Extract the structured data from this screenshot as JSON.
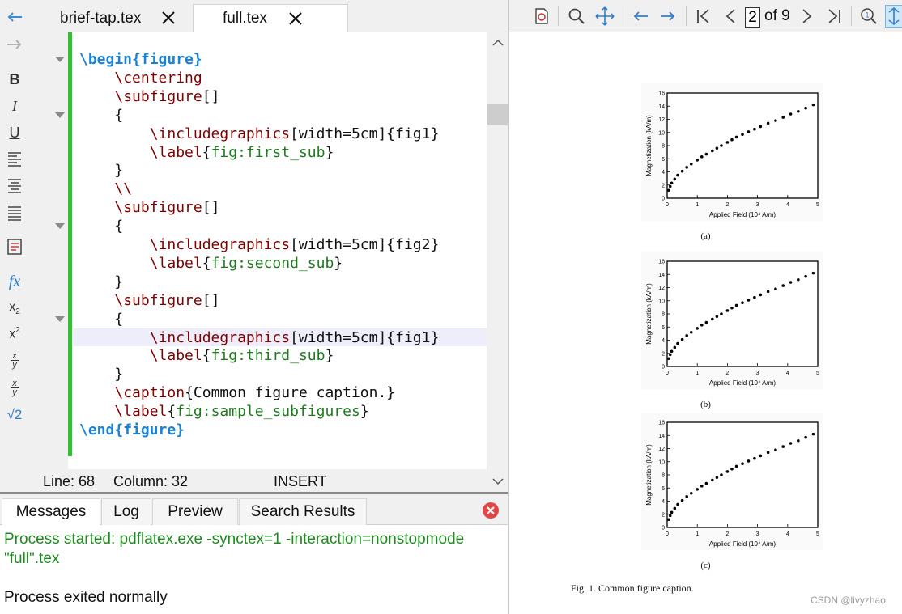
{
  "editor": {
    "tabs": [
      {
        "label": "brief-tap.tex",
        "active": false
      },
      {
        "label": "full.tex",
        "active": true
      }
    ],
    "lines": [
      {
        "indent": "",
        "parts": [
          [
            "kw",
            "\\begin"
          ],
          [
            "kw",
            "{"
          ],
          [
            "kw",
            "figure"
          ],
          [
            "kw",
            "}"
          ]
        ]
      },
      {
        "indent": "    ",
        "parts": [
          [
            "cmd",
            "\\centering"
          ]
        ]
      },
      {
        "indent": "    ",
        "parts": [
          [
            "cmd",
            "\\subfigure"
          ],
          [
            "",
            "[]"
          ]
        ]
      },
      {
        "indent": "    ",
        "parts": [
          [
            "",
            "{"
          ]
        ]
      },
      {
        "indent": "        ",
        "parts": [
          [
            "cmd",
            "\\includegraphics"
          ],
          [
            "",
            "[width=5cm]{fig1}"
          ]
        ]
      },
      {
        "indent": "        ",
        "parts": [
          [
            "cmd",
            "\\label"
          ],
          [
            "",
            "{"
          ],
          [
            "grn",
            "fig:first_sub"
          ],
          [
            "",
            "}"
          ]
        ]
      },
      {
        "indent": "    ",
        "parts": [
          [
            "",
            "}"
          ]
        ]
      },
      {
        "indent": "    ",
        "parts": [
          [
            "cmd",
            "\\\\"
          ]
        ]
      },
      {
        "indent": "    ",
        "parts": [
          [
            "cmd",
            "\\subfigure"
          ],
          [
            "",
            "[]"
          ]
        ]
      },
      {
        "indent": "    ",
        "parts": [
          [
            "",
            "{"
          ]
        ]
      },
      {
        "indent": "        ",
        "parts": [
          [
            "cmd",
            "\\includegraphics"
          ],
          [
            "",
            "[width=5cm]{fig2}"
          ]
        ]
      },
      {
        "indent": "        ",
        "parts": [
          [
            "cmd",
            "\\label"
          ],
          [
            "",
            "{"
          ],
          [
            "grn",
            "fig:second_sub"
          ],
          [
            "",
            "}"
          ]
        ]
      },
      {
        "indent": "    ",
        "parts": [
          [
            "",
            "}"
          ]
        ]
      },
      {
        "indent": "    ",
        "parts": [
          [
            "cmd",
            "\\subfigure"
          ],
          [
            "",
            "[]"
          ]
        ]
      },
      {
        "indent": "    ",
        "parts": [
          [
            "",
            "{"
          ]
        ]
      },
      {
        "indent": "        ",
        "parts": [
          [
            "cmd",
            "\\includegraphics"
          ],
          [
            "",
            "[width=5cm]{fig1}"
          ]
        ]
      },
      {
        "indent": "        ",
        "parts": [
          [
            "cmd",
            "\\label"
          ],
          [
            "",
            "{"
          ],
          [
            "grn",
            "fig:third_sub"
          ],
          [
            "",
            "}"
          ]
        ]
      },
      {
        "indent": "    ",
        "parts": [
          [
            "",
            "}"
          ]
        ]
      },
      {
        "indent": "    ",
        "parts": [
          [
            "cmd",
            "\\caption"
          ],
          [
            "",
            "{Common figure caption.}"
          ]
        ]
      },
      {
        "indent": "    ",
        "parts": [
          [
            "cmd",
            "\\label"
          ],
          [
            "",
            "{"
          ],
          [
            "grn",
            "fig:sample_subfigures"
          ],
          [
            "",
            "}"
          ]
        ]
      },
      {
        "indent": "",
        "parts": [
          [
            "kw",
            "\\end"
          ],
          [
            "kw",
            "{"
          ],
          [
            "kw",
            "figure"
          ],
          [
            "kw",
            "}"
          ]
        ]
      }
    ],
    "current_line_index": 15,
    "fold_lines": [
      0,
      3,
      9,
      14
    ]
  },
  "status": {
    "line": "Line: 68",
    "column": "Column: 32",
    "mode": "INSERT"
  },
  "bottom": {
    "tabs": [
      "Messages",
      "Log",
      "Preview",
      "Search Results"
    ],
    "active_tab": "Messages",
    "messages": [
      {
        "text": "Process started: pdflatex.exe -synctex=1 -interaction=nonstopmode",
        "color": "#1f8a1f"
      },
      {
        "text": "\"full\".tex",
        "color": "#1f8a1f"
      },
      {
        "text": "",
        "color": "#111111"
      },
      {
        "text": "Process exited normally",
        "color": "#111111"
      }
    ]
  },
  "left_toolbar": {
    "icons": [
      "back-arrow-icon",
      "forward-arrow-icon",
      "bold-icon",
      "italic-icon",
      "underline-icon",
      "align-left-icon",
      "align-center-icon",
      "align-justify-icon",
      "insert-item-icon",
      "function-fx-icon",
      "subscript-icon",
      "superscript-icon",
      "fraction-icon",
      "fraction-alt-icon",
      "square-root-icon"
    ]
  },
  "viewer": {
    "page_current": "2",
    "page_total_label": "of 9",
    "toolbar_icons": [
      "sync-pdf-icon",
      "zoom-icon",
      "pan-icon",
      "prev-arrow-icon",
      "next-arrow-icon",
      "first-page-icon",
      "prev-page-icon",
      "next-page-icon",
      "last-page-icon",
      "zoom-100-icon",
      "fit-icon"
    ],
    "watermark": "CSDN @livyzhao",
    "figure_caption": "Fig. 1.  Common figure caption.",
    "subcaptions": [
      "(a)",
      "(b)",
      "(c)"
    ]
  },
  "chart_data": [
    {
      "type": "scatter",
      "xlabel": "Applied Field (10⁴ A/m)",
      "ylabel": "Magnetization (kA/m)",
      "xlim": [
        0,
        5
      ],
      "ylim": [
        0,
        16
      ],
      "xticks": [
        "0",
        "1",
        "2",
        "3",
        "4",
        "5"
      ],
      "yticks": [
        "0",
        "2",
        "4",
        "6",
        "8",
        "10",
        "12",
        "14",
        "16"
      ],
      "x": [
        0.05,
        0.1,
        0.15,
        0.25,
        0.35,
        0.5,
        0.65,
        0.8,
        1.0,
        1.15,
        1.3,
        1.5,
        1.65,
        1.8,
        2.0,
        2.15,
        2.3,
        2.5,
        2.7,
        2.9,
        3.1,
        3.35,
        3.6,
        3.85,
        4.1,
        4.35,
        4.6,
        4.85
      ],
      "y": [
        1.2,
        1.8,
        2.3,
        2.9,
        3.5,
        4.1,
        4.7,
        5.2,
        5.8,
        6.3,
        6.7,
        7.2,
        7.6,
        8.0,
        8.5,
        8.9,
        9.3,
        9.7,
        10.1,
        10.5,
        10.9,
        11.4,
        11.8,
        12.3,
        12.8,
        13.2,
        13.7,
        14.2
      ]
    },
    {
      "type": "scatter",
      "xlabel": "Applied Field (10⁴ A/m)",
      "ylabel": "Magnetization (kA/m)",
      "xlim": [
        0,
        5
      ],
      "ylim": [
        0,
        16
      ],
      "xticks": [
        "0",
        "1",
        "2",
        "3",
        "4",
        "5"
      ],
      "yticks": [
        "0",
        "2",
        "4",
        "6",
        "8",
        "10",
        "12",
        "14",
        "16"
      ],
      "x": [
        0.05,
        0.1,
        0.15,
        0.25,
        0.35,
        0.5,
        0.65,
        0.8,
        1.0,
        1.15,
        1.3,
        1.5,
        1.65,
        1.8,
        2.0,
        2.15,
        2.3,
        2.5,
        2.7,
        2.9,
        3.1,
        3.35,
        3.6,
        3.85,
        4.1,
        4.35,
        4.6,
        4.85
      ],
      "y": [
        1.2,
        1.8,
        2.3,
        2.9,
        3.5,
        4.1,
        4.7,
        5.2,
        5.8,
        6.3,
        6.7,
        7.2,
        7.6,
        8.0,
        8.5,
        8.9,
        9.3,
        9.7,
        10.1,
        10.5,
        10.9,
        11.4,
        11.8,
        12.3,
        12.8,
        13.2,
        13.7,
        14.2
      ]
    },
    {
      "type": "scatter",
      "xlabel": "Applied Field (10⁴ A/m)",
      "ylabel": "Magnetization (kA/m)",
      "xlim": [
        0,
        5
      ],
      "ylim": [
        0,
        16
      ],
      "xticks": [
        "0",
        "1",
        "2",
        "3",
        "4",
        "5"
      ],
      "yticks": [
        "0",
        "2",
        "4",
        "6",
        "8",
        "10",
        "12",
        "14",
        "16"
      ],
      "x": [
        0.05,
        0.1,
        0.15,
        0.25,
        0.35,
        0.5,
        0.65,
        0.8,
        1.0,
        1.15,
        1.3,
        1.5,
        1.65,
        1.8,
        2.0,
        2.15,
        2.3,
        2.5,
        2.7,
        2.9,
        3.1,
        3.35,
        3.6,
        3.85,
        4.1,
        4.35,
        4.6,
        4.85
      ],
      "y": [
        1.2,
        1.8,
        2.3,
        2.9,
        3.5,
        4.1,
        4.7,
        5.2,
        5.8,
        6.3,
        6.7,
        7.2,
        7.6,
        8.0,
        8.5,
        8.9,
        9.3,
        9.7,
        10.1,
        10.5,
        10.9,
        11.4,
        11.8,
        12.3,
        12.8,
        13.2,
        13.7,
        14.2
      ]
    }
  ]
}
